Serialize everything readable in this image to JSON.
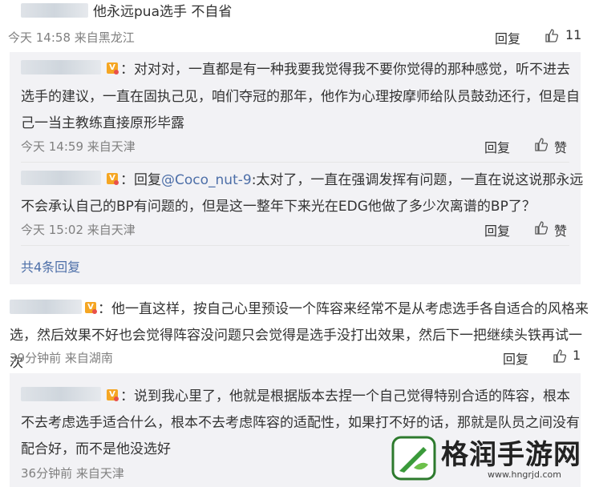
{
  "comments": [
    {
      "text": "他永远pua选手 不自省",
      "time": "今天 14:58",
      "location": "来自黑龙江",
      "reply_label": "回复",
      "likes": "11"
    },
    {
      "text_lines": [
        "：对对对，一直都是有一种我要我觉得我不要你觉得的那种感觉，听不进去",
        "选手的建议，一直在固执己见，咱们夺冠的那年，他作为心理按摩师给队员鼓劲还行，但是自",
        "己一当主教练直接原形毕露"
      ],
      "time": "今天 14:59",
      "location": "来自天津",
      "reply_label": "回复",
      "like_label": "赞"
    },
    {
      "prefix": "：回复",
      "mention": "@Coco_nut-9",
      "text_lines": [
        ":太对了，一直在强调发挥有问题，一直在说这说那永远",
        "不会承认自己的BP有问题的，但是这一整年下来光在EDG他做了多少次离谱的BP了？"
      ],
      "time": "今天 15:02",
      "location": "来自天津",
      "reply_label": "回复",
      "like_label": "赞"
    },
    {
      "text_lines": [
        "：他一直这样，按自己心里预设一个阵容来经常不是从考虑选手各自适合的风格来",
        "选，然后效果不好也会觉得阵容没问题只会觉得是选手没打出效果，然后下一把继续头铁再试一次"
      ],
      "time": "39分钟前",
      "location": "来自湖南",
      "reply_label": "回复",
      "likes": "1"
    },
    {
      "text_lines": [
        "：说到我心里了，他就是根据版本去捏一个自己觉得特别合适的阵容，根本",
        "不去考虑选手适合什么，根本不去考虑阵容的适配性，如果打不好的话，那就是队员之间没有",
        "配合好，而不是他没选好"
      ],
      "time": "36分钟前",
      "location": "来自天津"
    }
  ],
  "more_replies": "共4条回复",
  "watermark": {
    "name": "格润手游网",
    "url": "www.hngrjd.com"
  },
  "colors": {
    "link": "#4d6fa8",
    "meta": "#808080",
    "reply_bg": "#f2f2f5"
  }
}
